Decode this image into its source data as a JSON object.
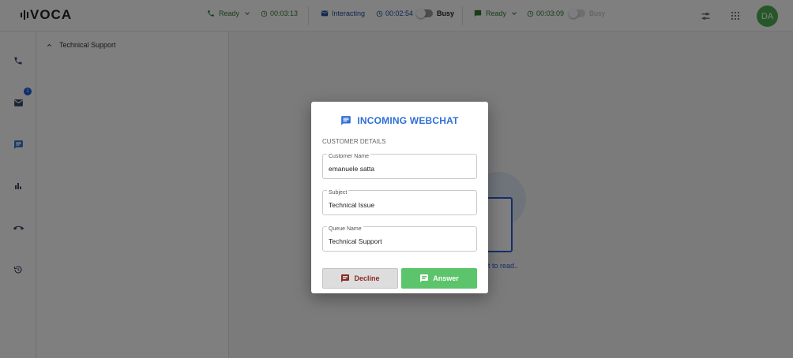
{
  "app": {
    "logo": "VOCA"
  },
  "topbar": {
    "voice": {
      "status": "Ready",
      "timer": "00:03:13"
    },
    "email": {
      "status": "Interacting",
      "timer": "00:02:54",
      "busy_label": "Busy"
    },
    "chat": {
      "status": "Ready",
      "timer": "00:03:09",
      "busy_label": "Busy"
    },
    "avatar_initials": "DA"
  },
  "sidebar": {
    "items": [
      {
        "icon": "phone-icon"
      },
      {
        "icon": "mail-icon",
        "badge": "1"
      },
      {
        "icon": "chat-icon"
      },
      {
        "icon": "bar-chart-icon"
      },
      {
        "icon": "call-split-icon"
      },
      {
        "icon": "history-icon"
      }
    ]
  },
  "queue_panel": {
    "title": "Technical Support"
  },
  "main": {
    "empty_text": "t to read.."
  },
  "modal": {
    "title": "INCOMING WEBCHAT",
    "section_label": "CUSTOMER DETAILS",
    "fields": [
      {
        "label": "Customer Name",
        "value": "emanuele satta"
      },
      {
        "label": "Subject",
        "value": "Technical Issue"
      },
      {
        "label": "Queue Name",
        "value": "Technical Support"
      }
    ],
    "decline_label": "Decline",
    "answer_label": "Answer"
  },
  "colors": {
    "accent_blue": "#2f6fd6",
    "answer_green": "#5cc46b",
    "decline_red": "#8a2b25",
    "ready_green": "#2e7d32",
    "avatar_green": "#4caf50"
  }
}
